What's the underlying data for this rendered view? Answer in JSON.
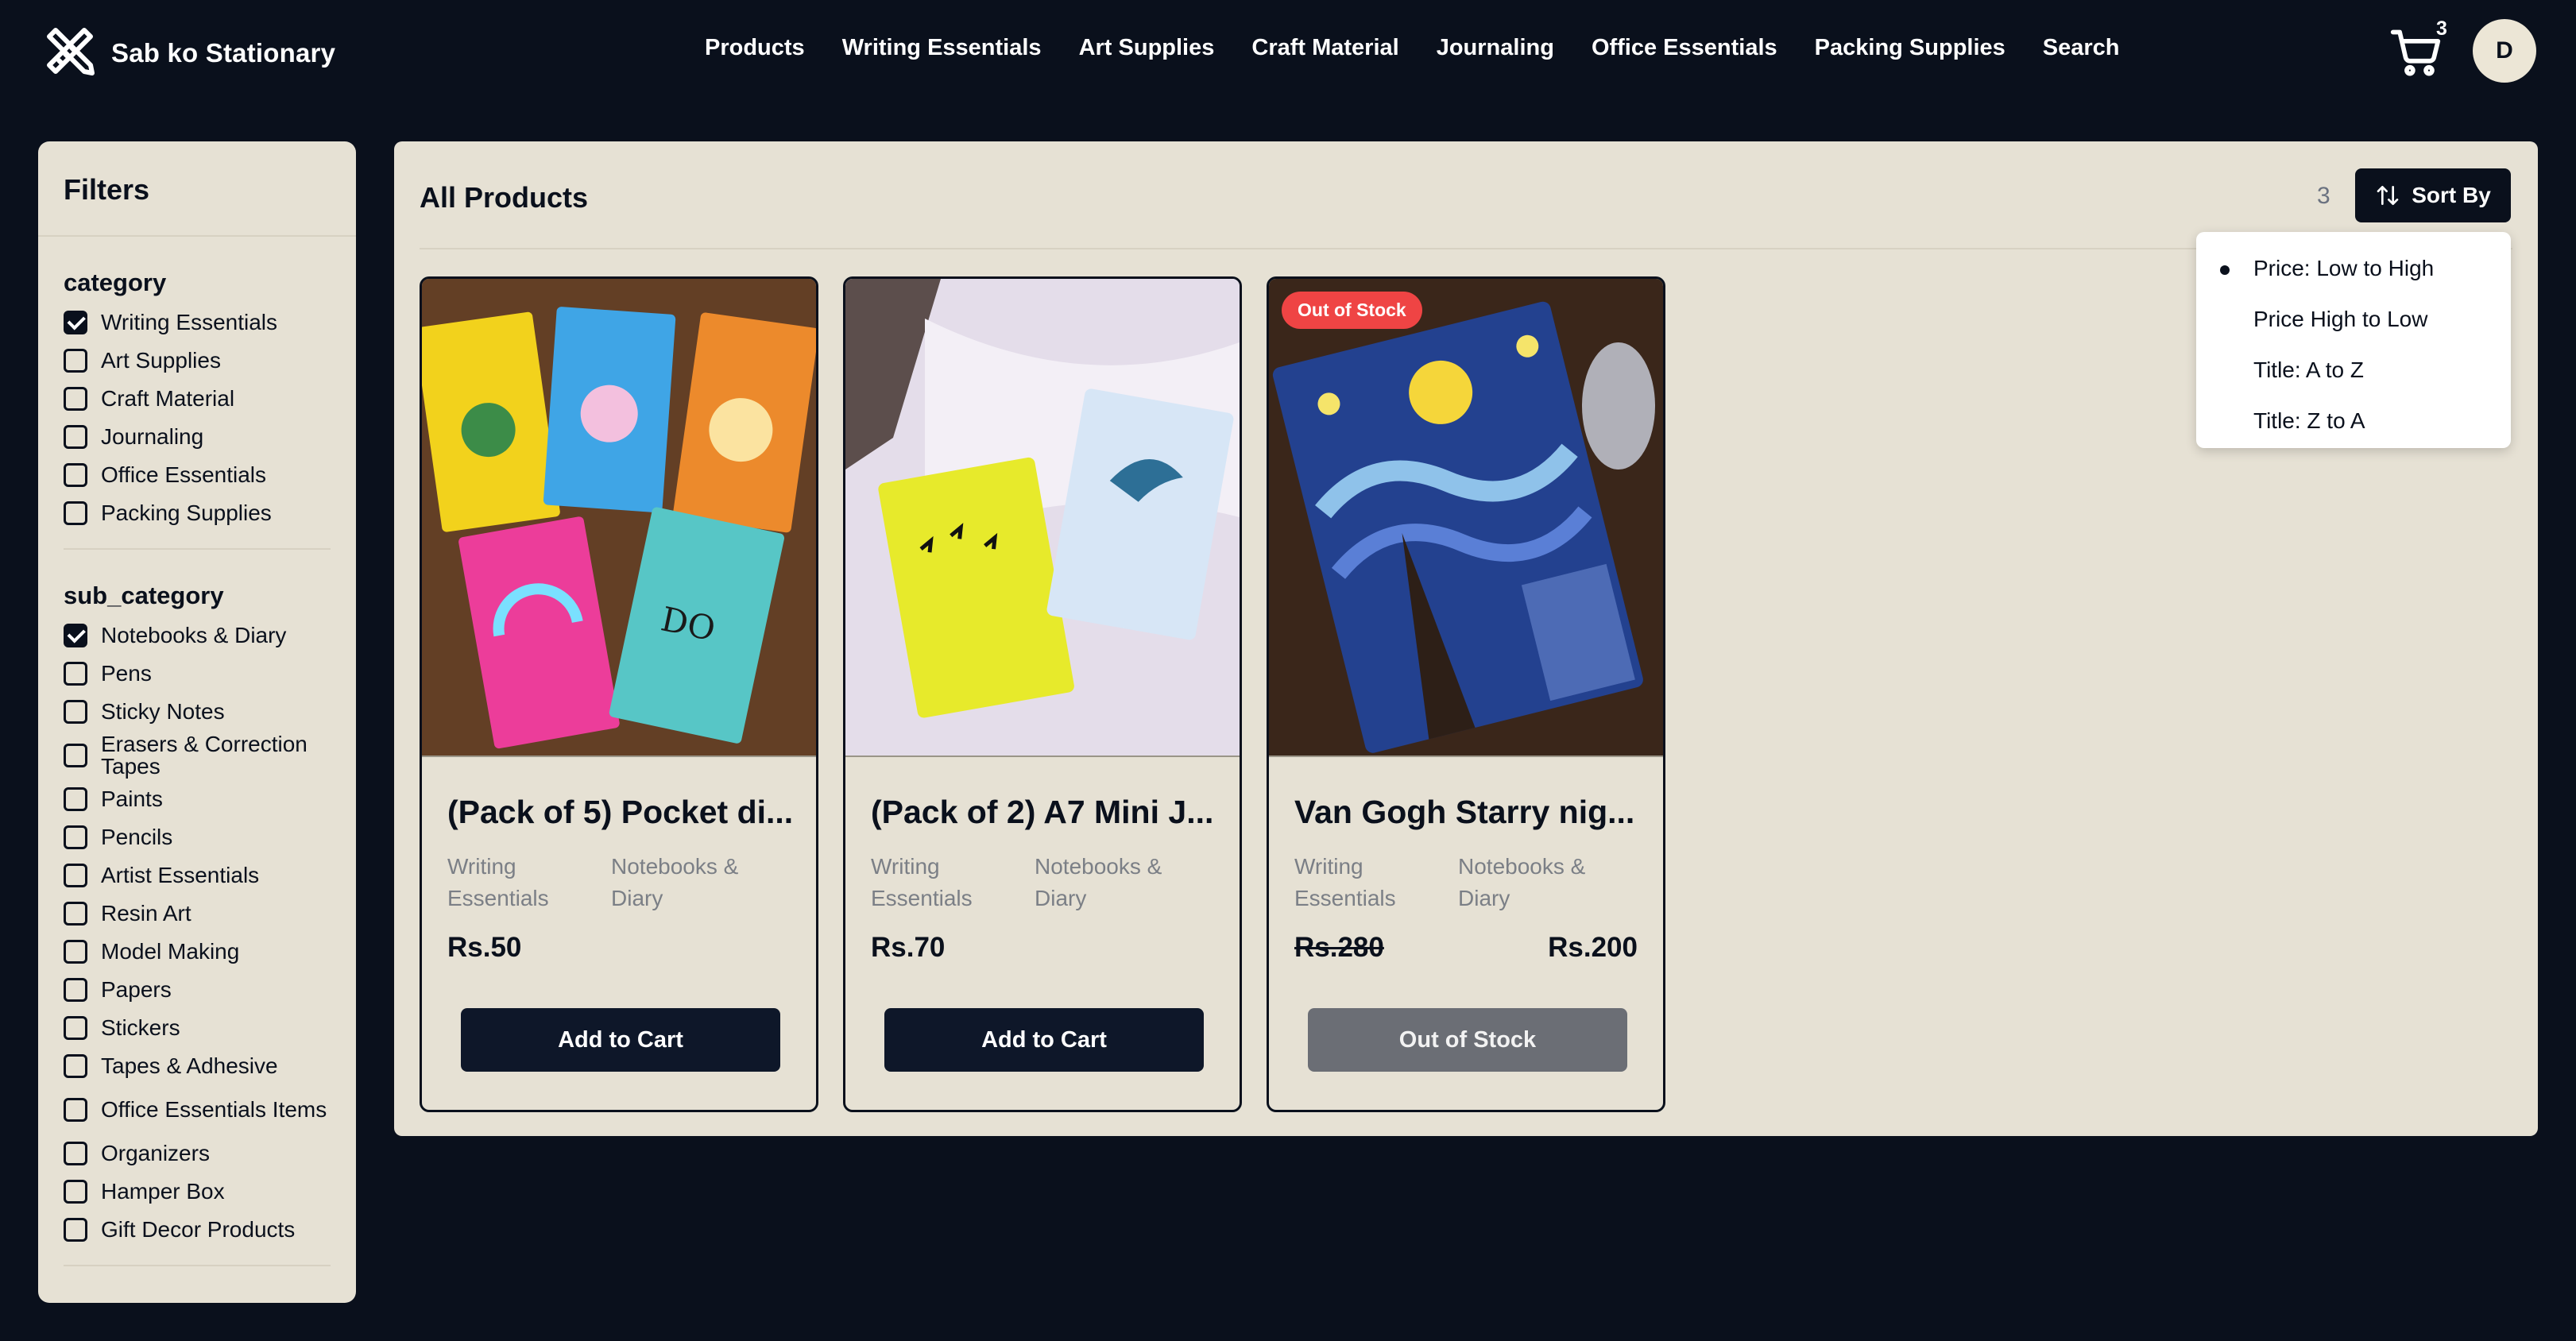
{
  "brand": {
    "name": "Sab ko Stationary"
  },
  "nav": [
    "Products",
    "Writing Essentials",
    "Art Supplies",
    "Craft Material",
    "Journaling",
    "Office Essentials",
    "Packing Supplies",
    "Search"
  ],
  "cart": {
    "count": "3"
  },
  "user": {
    "initial": "D"
  },
  "filters": {
    "title": "Filters",
    "category": {
      "title": "category",
      "options": [
        {
          "label": "Writing Essentials",
          "checked": true
        },
        {
          "label": "Art Supplies",
          "checked": false
        },
        {
          "label": "Craft Material",
          "checked": false
        },
        {
          "label": "Journaling",
          "checked": false
        },
        {
          "label": "Office Essentials",
          "checked": false
        },
        {
          "label": "Packing Supplies",
          "checked": false
        }
      ]
    },
    "sub_category": {
      "title": "sub_category",
      "options": [
        {
          "label": "Notebooks & Diary",
          "checked": true
        },
        {
          "label": "Pens",
          "checked": false
        },
        {
          "label": "Sticky Notes",
          "checked": false
        },
        {
          "label": "Erasers & Correction Tapes",
          "checked": false
        },
        {
          "label": "Paints",
          "checked": false
        },
        {
          "label": "Pencils",
          "checked": false
        },
        {
          "label": "Artist Essentials",
          "checked": false
        },
        {
          "label": "Resin Art",
          "checked": false
        },
        {
          "label": "Model Making",
          "checked": false
        },
        {
          "label": "Papers",
          "checked": false
        },
        {
          "label": "Stickers",
          "checked": false
        },
        {
          "label": "Tapes & Adhesive",
          "checked": false
        },
        {
          "label": "Office Essentials Items",
          "checked": false
        },
        {
          "label": "Organizers",
          "checked": false
        },
        {
          "label": "Hamper Box",
          "checked": false
        },
        {
          "label": "Gift Decor Products",
          "checked": false
        }
      ]
    }
  },
  "main": {
    "title": "All Products",
    "count": "3",
    "sort_label": "Sort By"
  },
  "sort_options": [
    {
      "label": "Price: Low to High",
      "selected": true
    },
    {
      "label": "Price High to Low",
      "selected": false
    },
    {
      "label": "Title: A to Z",
      "selected": false
    },
    {
      "label": "Title: Z to A",
      "selected": false
    }
  ],
  "products": [
    {
      "title": "(Pack of 5) Pocket di...",
      "category": "Writing Essentials",
      "sub_category": "Notebooks & Diary",
      "price": "Rs.50",
      "button": "Add to Cart"
    },
    {
      "title": "(Pack of 2) A7 Mini J...",
      "category": "Writing Essentials",
      "sub_category": "Notebooks & Diary",
      "price": "Rs.70",
      "button": "Add to Cart"
    },
    {
      "title": "Van Gogh Starry nig...",
      "category": "Writing Essentials",
      "sub_category": "Notebooks & Diary",
      "old_price": "Rs.280",
      "price": "Rs.200",
      "button": "Out of Stock",
      "badge": "Out of Stock"
    }
  ]
}
